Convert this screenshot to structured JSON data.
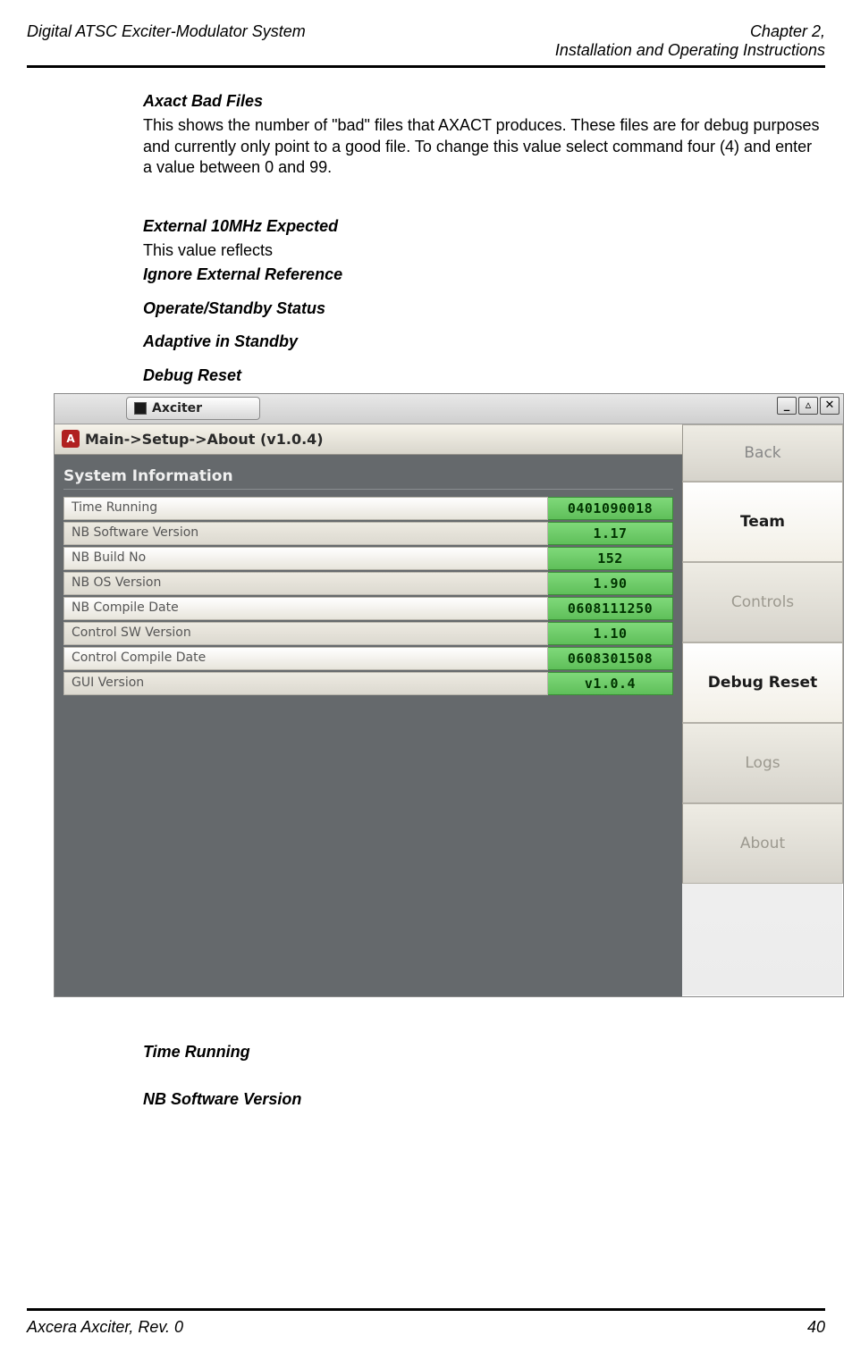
{
  "header": {
    "left": "Digital ATSC Exciter-Modulator System",
    "right_line1": "Chapter 2,",
    "right_line2": "Installation and Operating Instructions"
  },
  "sections": {
    "axact_heading": "Axact Bad Files",
    "axact_body": "This shows the number of \"bad\" files that AXACT produces.  These files are for debug purposes and currently only point to a good file.  To change this value select command four (4) and enter a value between 0 and 99.",
    "ext10_heading": "External 10MHz Expected",
    "ext10_body": "This value reflects",
    "ignore_ext": "Ignore External Reference",
    "op_standby": "Operate/Standby Status",
    "adaptive": "Adaptive in Standby",
    "debug_reset": "Debug Reset",
    "time_running_h": "Time Running",
    "nb_sw_h": "NB Software Version"
  },
  "screenshot": {
    "task_label": "Axciter",
    "breadcrumb": "Main->Setup->About (v1.0.4)",
    "section_title": "System Information",
    "rows": [
      {
        "label": "Time Running",
        "value": "0401090018"
      },
      {
        "label": "NB Software Version",
        "value": "1.17"
      },
      {
        "label": "NB Build No",
        "value": "152"
      },
      {
        "label": "NB OS Version",
        "value": "1.90"
      },
      {
        "label": "NB Compile Date",
        "value": "0608111250"
      },
      {
        "label": "Control SW Version",
        "value": "1.10"
      },
      {
        "label": "Control Compile Date",
        "value": "0608301508"
      },
      {
        "label": "GUI Version",
        "value": "v1.0.4"
      }
    ],
    "side": {
      "back": "Back",
      "team": "Team",
      "controls": "Controls",
      "debug_reset": "Debug Reset",
      "logs": "Logs",
      "about": "About"
    }
  },
  "footer": {
    "left": "Axcera Axciter, Rev. 0",
    "right": "40"
  }
}
